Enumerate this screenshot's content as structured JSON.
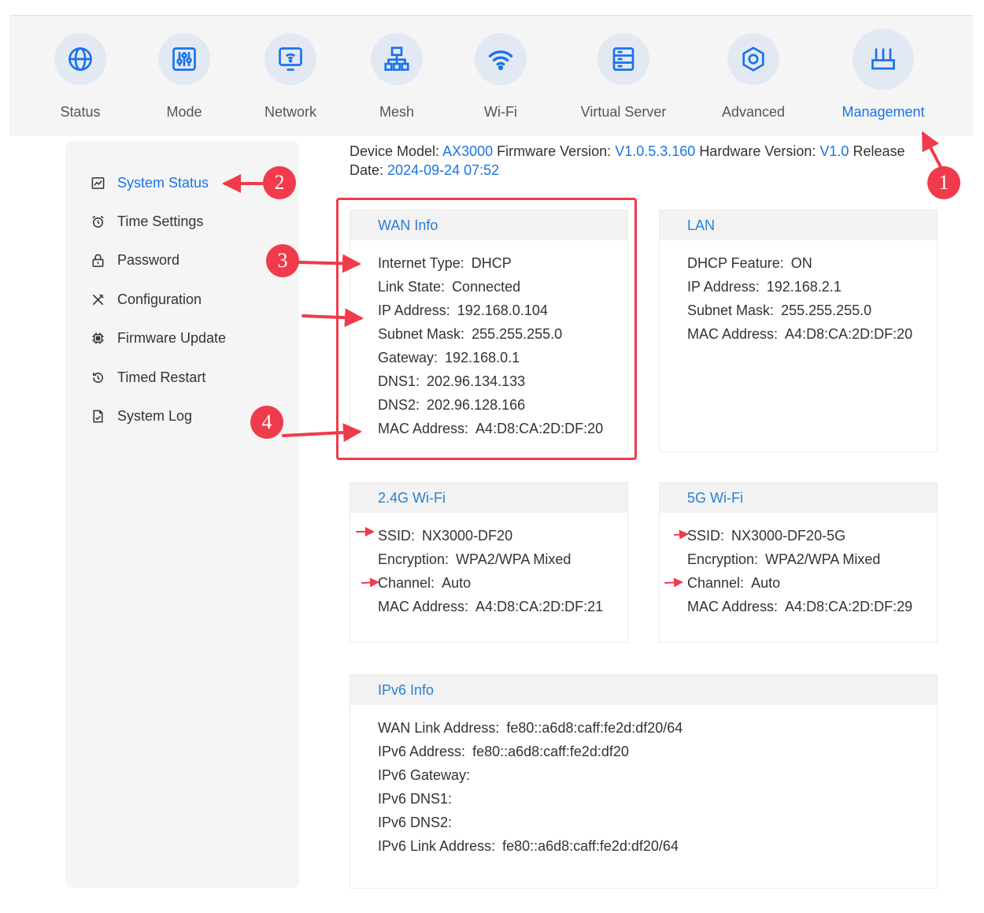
{
  "nav": {
    "items": [
      {
        "label": "Status",
        "icon": "globe-icon"
      },
      {
        "label": "Mode",
        "icon": "sliders-icon"
      },
      {
        "label": "Network",
        "icon": "network-monitor-icon"
      },
      {
        "label": "Mesh",
        "icon": "mesh-topology-icon"
      },
      {
        "label": "Wi-Fi",
        "icon": "wifi-icon"
      },
      {
        "label": "Virtual Server",
        "icon": "server-icon"
      },
      {
        "label": "Advanced",
        "icon": "hexagon-icon"
      },
      {
        "label": "Management",
        "icon": "router-icon"
      }
    ],
    "active": "Management"
  },
  "sidebar": {
    "items": [
      {
        "label": "System Status",
        "icon": "chart-icon"
      },
      {
        "label": "Time Settings",
        "icon": "alarm-clock-icon"
      },
      {
        "label": "Password",
        "icon": "lock-icon"
      },
      {
        "label": "Configuration",
        "icon": "tools-icon"
      },
      {
        "label": "Firmware Update",
        "icon": "chip-icon"
      },
      {
        "label": "Timed Restart",
        "icon": "restart-icon"
      },
      {
        "label": "System Log",
        "icon": "log-file-icon"
      }
    ],
    "active": "System Status"
  },
  "device": {
    "model_label": "Device Model:",
    "model": "AX3000",
    "firmware_label": "Firmware Version:",
    "firmware": "V1.0.5.3.160",
    "hardware_label": "Hardware Version:",
    "hardware": "V1.0",
    "release_label": "Release",
    "date_label": "Date:",
    "date": "2024-09-24 07:52"
  },
  "wan": {
    "title": "WAN Info",
    "rows": [
      {
        "key": "Internet Type:",
        "value": "DHCP"
      },
      {
        "key": "Link State:",
        "value": "Connected"
      },
      {
        "key": "IP Address:",
        "value": "192.168.0.104"
      },
      {
        "key": "Subnet Mask:",
        "value": "255.255.255.0"
      },
      {
        "key": "Gateway:",
        "value": "192.168.0.1"
      },
      {
        "key": "DNS1:",
        "value": "202.96.134.133"
      },
      {
        "key": "DNS2:",
        "value": "202.96.128.166"
      },
      {
        "key": "MAC Address:",
        "value": "A4:D8:CA:2D:DF:20"
      }
    ]
  },
  "lan": {
    "title": "LAN",
    "rows": [
      {
        "key": "DHCP Feature:",
        "value": "ON"
      },
      {
        "key": "IP Address:",
        "value": "192.168.2.1"
      },
      {
        "key": "Subnet Mask:",
        "value": "255.255.255.0"
      },
      {
        "key": "MAC Address:",
        "value": "A4:D8:CA:2D:DF:20"
      }
    ]
  },
  "wifi24": {
    "title": "2.4G Wi-Fi",
    "rows": [
      {
        "key": "SSID:",
        "value": "NX3000-DF20"
      },
      {
        "key": "Encryption:",
        "value": "WPA2/WPA Mixed"
      },
      {
        "key": "Channel:",
        "value": "Auto"
      },
      {
        "key": "MAC Address:",
        "value": "A4:D8:CA:2D:DF:21"
      }
    ]
  },
  "wifi5": {
    "title": "5G Wi-Fi",
    "rows": [
      {
        "key": "SSID:",
        "value": "NX3000-DF20-5G"
      },
      {
        "key": "Encryption:",
        "value": "WPA2/WPA Mixed"
      },
      {
        "key": "Channel:",
        "value": "Auto"
      },
      {
        "key": "MAC Address:",
        "value": "A4:D8:CA:2D:DF:29"
      }
    ]
  },
  "ipv6": {
    "title": "IPv6 Info",
    "rows": [
      {
        "key": "WAN Link Address:",
        "value": "fe80::a6d8:caff:fe2d:df20/64"
      },
      {
        "key": "IPv6 Address:",
        "value": "fe80::a6d8:caff:fe2d:df20"
      },
      {
        "key": "IPv6 Gateway:",
        "value": ""
      },
      {
        "key": "IPv6 DNS1:",
        "value": ""
      },
      {
        "key": "IPv6 DNS2:",
        "value": ""
      },
      {
        "key": "IPv6 Link Address:",
        "value": "fe80::a6d8:caff:fe2d:df20/64"
      }
    ]
  },
  "annotations": {
    "badges": [
      "1",
      "2",
      "3",
      "4"
    ],
    "color": "#ef3b4c"
  },
  "colors": {
    "accent": "#1a73e8",
    "annotation": "#ef3b4c"
  }
}
